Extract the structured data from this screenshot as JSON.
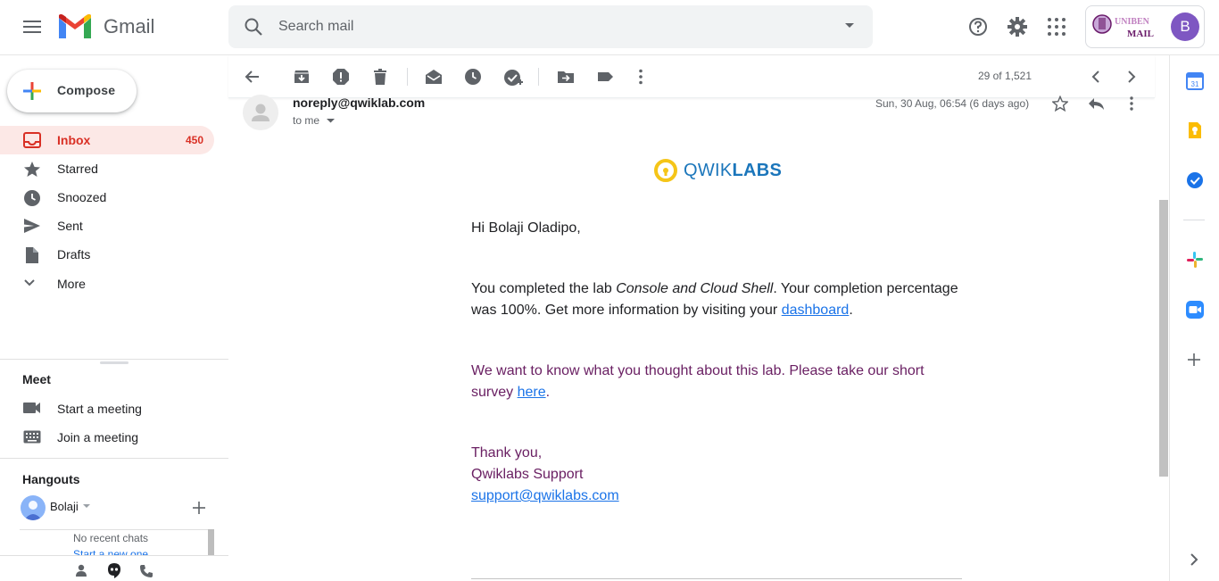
{
  "header": {
    "app_name": "Gmail",
    "search_placeholder": "Search mail",
    "account_logo_lines": [
      "UNIBEN",
      "MAIL"
    ],
    "avatar_initial": "B"
  },
  "sidebar": {
    "compose_label": "Compose",
    "items": [
      {
        "label": "Inbox",
        "count": "450",
        "icon": "inbox-icon"
      },
      {
        "label": "Starred",
        "icon": "star-icon"
      },
      {
        "label": "Snoozed",
        "icon": "clock-icon"
      },
      {
        "label": "Sent",
        "icon": "send-icon"
      },
      {
        "label": "Drafts",
        "icon": "draft-icon"
      },
      {
        "label": "More",
        "icon": "chevron-down-icon"
      }
    ],
    "meet": {
      "title": "Meet",
      "items": [
        {
          "label": "Start a meeting",
          "icon": "video-icon"
        },
        {
          "label": "Join a meeting",
          "icon": "keyboard-icon"
        }
      ]
    },
    "hangouts": {
      "title": "Hangouts",
      "user": "Bolaji",
      "no_chats": "No recent chats",
      "start_new": "Start a new one"
    }
  },
  "toolbar": {
    "pager": "29 of 1,521"
  },
  "message": {
    "from": "noreply@qwiklab.com",
    "to": "to me",
    "date": "Sun, 30 Aug, 06:54 (6 days ago)",
    "logo_text_light": "QWIK",
    "logo_text_bold": "LABS",
    "greeting": "Hi Bolaji Oladipo,",
    "p1_a": "You completed the lab ",
    "p1_lab": "Console and Cloud Shell",
    "p1_b": ". Your completion percentage was 100%. Get more information by visiting your ",
    "p1_link": "dashboard",
    "p1_c": ".",
    "p2_a": "We want to know what you thought about this lab. Please take our short survey ",
    "p2_link": "here",
    "p2_c": ".",
    "signoff": "Thank you,",
    "team": "Qwiklabs Support",
    "support_email": "support@qwiklabs.com"
  },
  "colors": {
    "inbox_active": "#d93025",
    "inbox_bg": "#fce8e6",
    "link": "#1a73e8",
    "purple_text": "#6a2063",
    "avatar": "#7e57c2"
  }
}
